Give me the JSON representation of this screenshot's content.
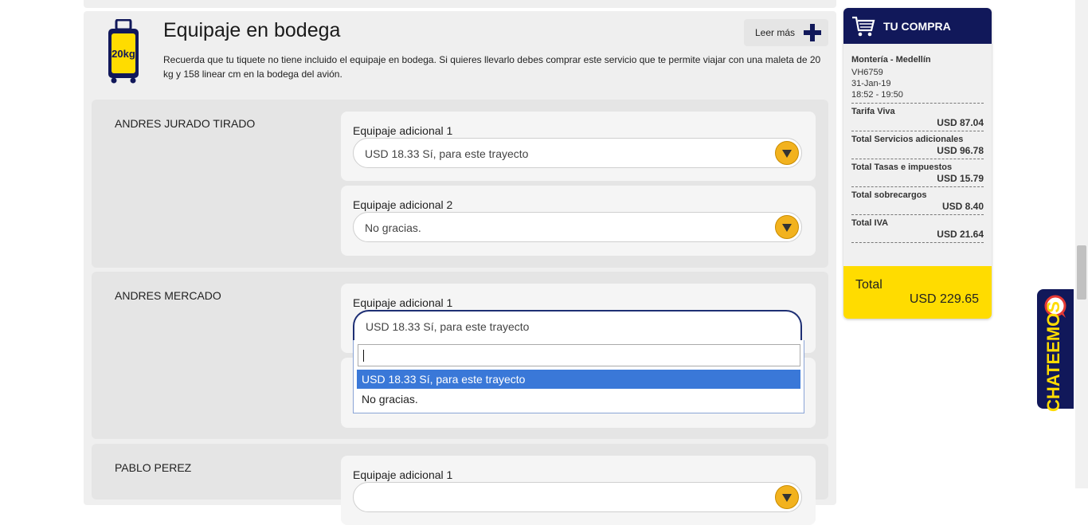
{
  "section": {
    "title": "Equipaje en bodega",
    "description": "Recuerda que tu tiquete no tiene incluido el equipaje en bodega. Si quieres llevarlo debes comprar este servicio que te permite viajar con una maleta de 20 kg y 158 linear cm en la bodega del avión.",
    "read_more": "Leer más",
    "suitcase_badge": "20kg"
  },
  "passengers": [
    {
      "name": "ANDRES JURADO TIRADO",
      "options": [
        {
          "label": "Equipaje adicional 1",
          "value": "USD 18.33 Sí, para este trayecto"
        },
        {
          "label": "Equipaje adicional 2",
          "value": "No gracias."
        }
      ]
    },
    {
      "name": "ANDRES MERCADO",
      "options": [
        {
          "label": "Equipaje adicional 1",
          "value": "USD 18.33 Sí, para este trayecto"
        }
      ]
    },
    {
      "name": "PABLO PEREZ",
      "options": [
        {
          "label": "Equipaje adicional 1",
          "value": ""
        }
      ]
    }
  ],
  "dropdown": {
    "search_value": "",
    "options": [
      "USD 18.33 Sí, para este trayecto",
      "No gracias."
    ],
    "highlighted_index": 0
  },
  "summary": {
    "title": "TU COMPRA",
    "route": "Montería - Medellín",
    "flight": "VH6759",
    "date": "31-Jan-19",
    "time": "18:52 - 19:50",
    "items": [
      {
        "label": "Tarifa Viva",
        "value": "USD 87.04"
      },
      {
        "label": "Total Servicios adicionales",
        "value": "USD 96.78"
      },
      {
        "label": "Total Tasas e impuestos",
        "value": "USD 15.79"
      },
      {
        "label": "Total sobrecargos",
        "value": "USD 8.40"
      },
      {
        "label": "Total IVA",
        "value": "USD 21.64"
      }
    ],
    "total_label": "Total",
    "total_value": "USD 229.65"
  },
  "chat": {
    "label": "CHATEEMOS"
  },
  "colors": {
    "brand_navy": "#11185a",
    "brand_yellow": "#ffdc00",
    "arrow_orange": "#f2b21e",
    "highlight_blue": "#3a78d8"
  }
}
